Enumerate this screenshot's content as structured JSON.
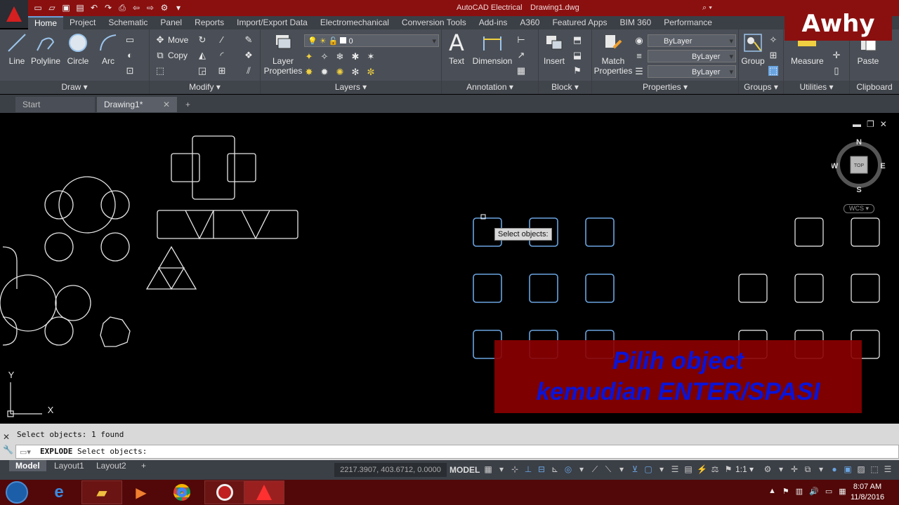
{
  "titlebar": {
    "app": "AutoCAD Electrical",
    "file": "Drawing1.dwg",
    "search_hint": "⌕ ▾"
  },
  "watermark": "Awhy",
  "ribbon_tabs": [
    "Home",
    "Project",
    "Schematic",
    "Panel",
    "Reports",
    "Import/Export Data",
    "Electromechanical",
    "Conversion Tools",
    "Add-ins",
    "A360",
    "Featured Apps",
    "BIM 360",
    "Performance"
  ],
  "draw": {
    "title": "Draw ▾",
    "line": "Line",
    "polyline": "Polyline",
    "circle": "Circle",
    "arc": "Arc"
  },
  "modify": {
    "title": "Modify ▾",
    "move": "Move",
    "copy": "Copy"
  },
  "layers": {
    "title": "Layers ▾",
    "props_l1": "Layer",
    "props_l2": "Properties",
    "current_layer": "0"
  },
  "annotation": {
    "title": "Annotation ▾",
    "text": "Text",
    "dimension": "Dimension"
  },
  "block": {
    "title": "Block ▾",
    "insert": "Insert"
  },
  "properties": {
    "title": "Properties ▾",
    "match_l1": "Match",
    "match_l2": "Properties",
    "color": "ByLayer",
    "linetype": "ByLayer",
    "lineweight": "ByLayer"
  },
  "groups": {
    "title": "Groups ▾",
    "group": "Group"
  },
  "utilities": {
    "title": "Utilities ▾",
    "measure": "Measure"
  },
  "clipboard": {
    "title": "Clipboard",
    "paste": "Paste"
  },
  "doc_tabs": {
    "start": "Start",
    "drawing": "Drawing1*",
    "close": "✕",
    "add": "+"
  },
  "viewcube": {
    "n": "N",
    "s": "S",
    "e": "E",
    "w": "W",
    "top": "TOP",
    "wcs": "WCS ▾"
  },
  "ucs": {
    "x": "X",
    "y": "Y"
  },
  "tooltip": "Select objects:",
  "overlay": {
    "line1": "Pilih object",
    "line2": "kemudian ENTER/SPASI"
  },
  "command": {
    "history": "Select objects: 1 found",
    "cmd": "EXPLODE",
    "prompt": "Select objects:"
  },
  "layout_tabs": {
    "model": "Model",
    "layout1": "Layout1",
    "layout2": "Layout2",
    "add": "+"
  },
  "status": {
    "coords": "2217.3907, 403.6712, 0.0000",
    "model": "MODEL",
    "scale": "1:1 ▾"
  },
  "clock": {
    "time": "8:07 AM",
    "date": "11/8/2016"
  },
  "colors": {
    "titlebar": "#8a1010",
    "ribbon": "#4a4f57",
    "selection": "#6aa4e0",
    "overlay_text": "#0a14d8"
  }
}
